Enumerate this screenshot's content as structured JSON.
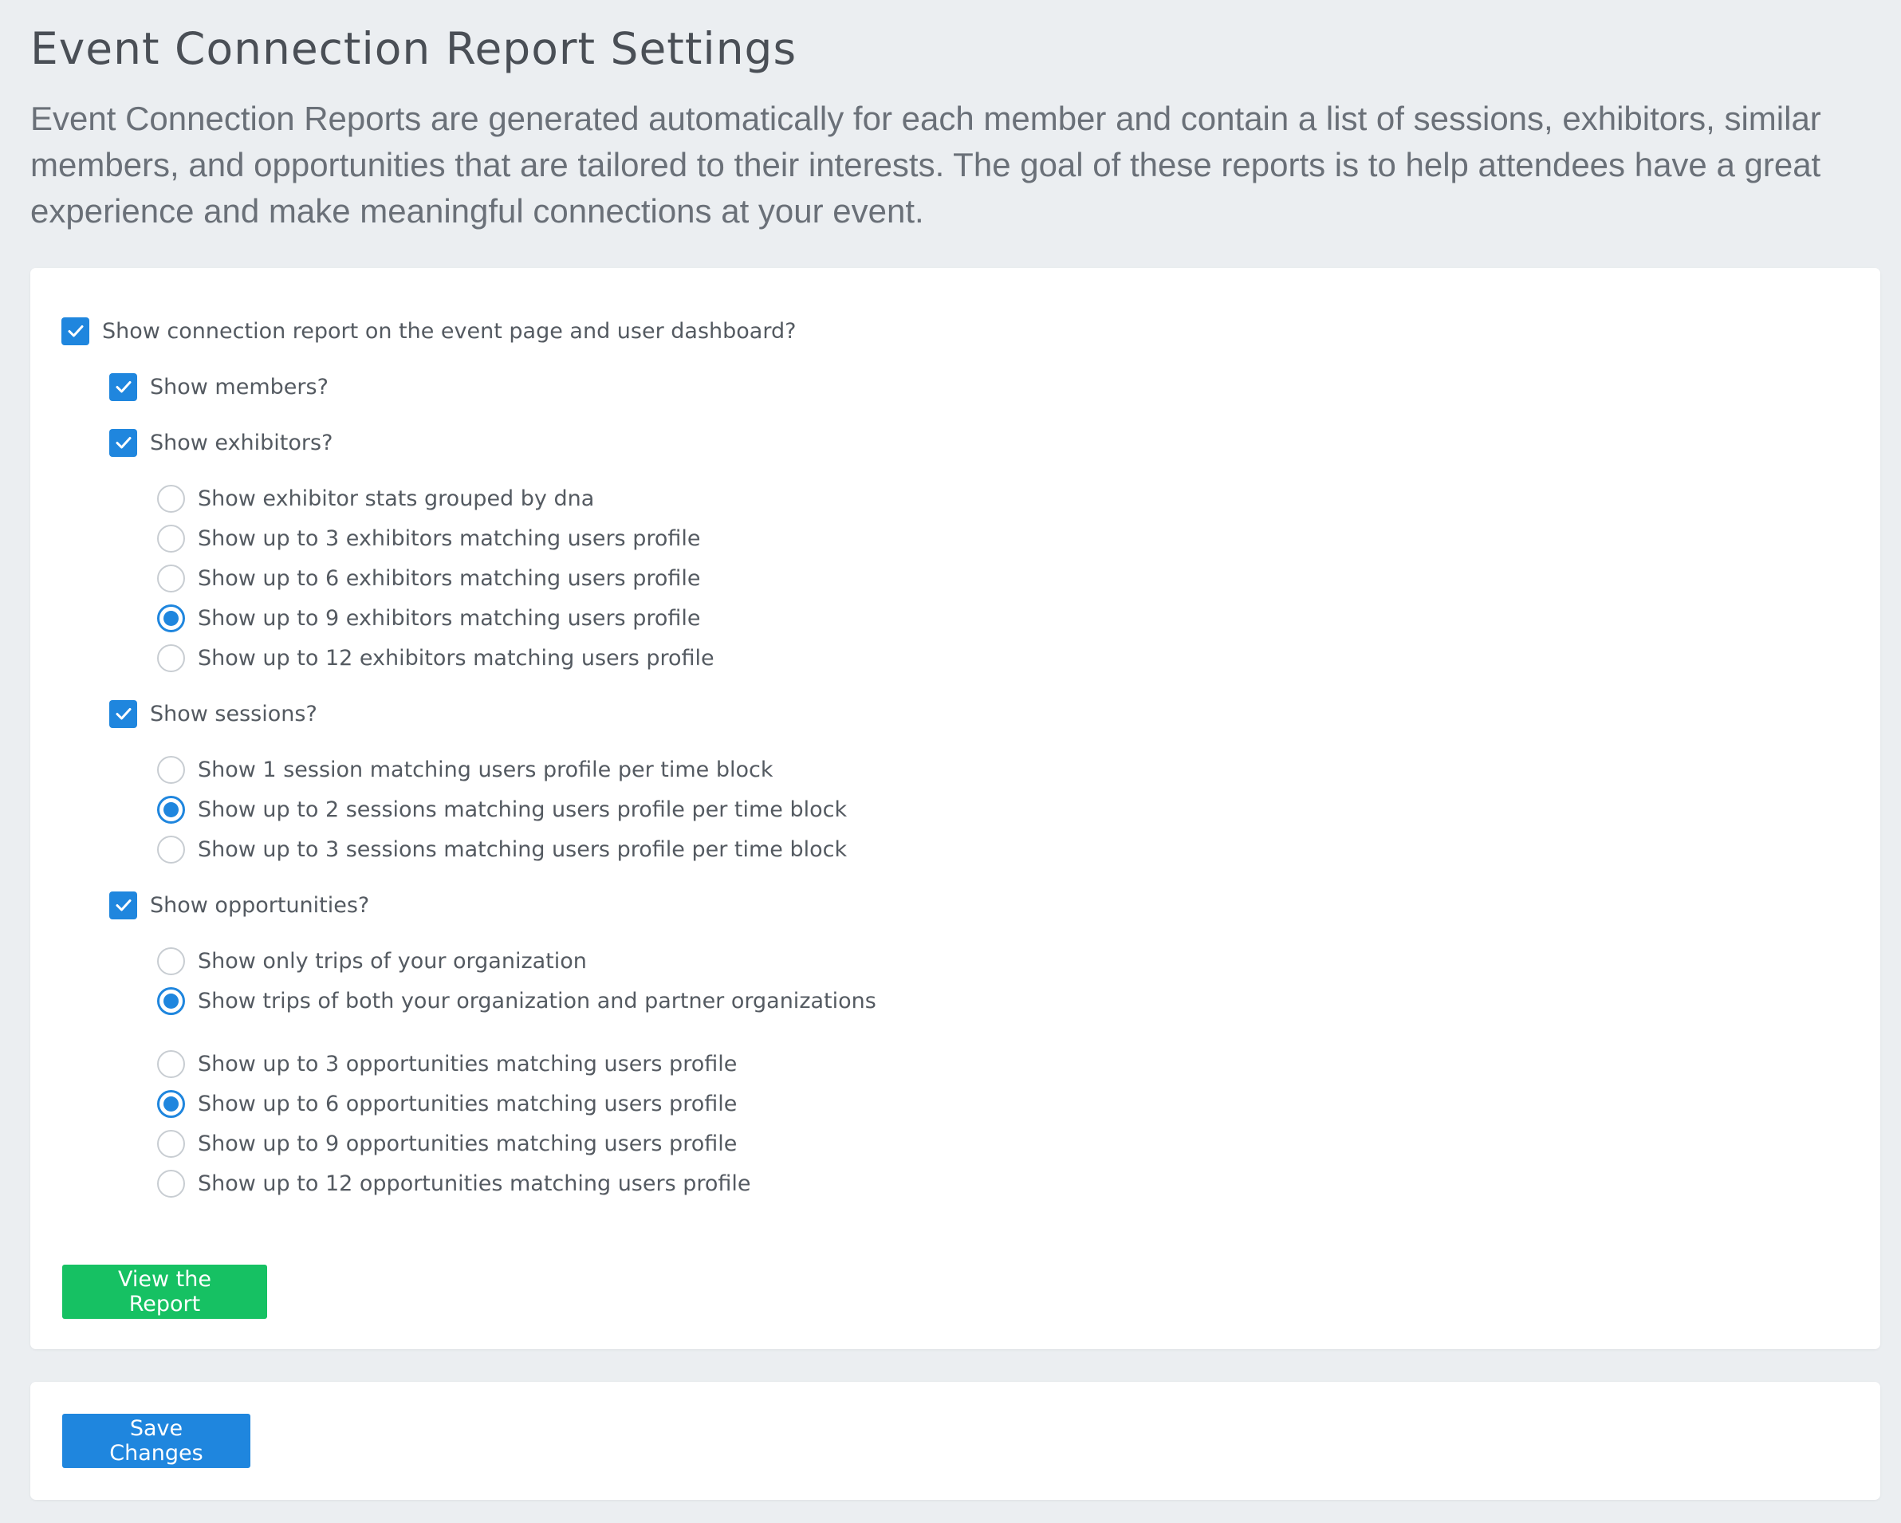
{
  "header": {
    "title": "Event Connection Report Settings",
    "description": "Event Connection Reports are generated automatically for each member and contain a list of sessions, exhibitors, similar members, and opportunities that are tailored to their interests. The goal of these reports is to help attendees have a great experience and make meaningful connections at your event."
  },
  "settings": {
    "show_report": {
      "label": "Show connection report on the event page and user dashboard?",
      "checked": true
    },
    "show_members": {
      "label": "Show members?",
      "checked": true
    },
    "show_exhibitors": {
      "label": "Show exhibitors?",
      "checked": true
    },
    "exhibitor_options": [
      {
        "label": "Show exhibitor stats grouped by dna",
        "selected": false
      },
      {
        "label": "Show up to 3 exhibitors matching users profile",
        "selected": false
      },
      {
        "label": "Show up to 6 exhibitors matching users profile",
        "selected": false
      },
      {
        "label": "Show up to 9 exhibitors matching users profile",
        "selected": true
      },
      {
        "label": "Show up to 12 exhibitors matching users profile",
        "selected": false
      }
    ],
    "show_sessions": {
      "label": "Show sessions?",
      "checked": true
    },
    "session_options": [
      {
        "label": "Show 1 session matching users profile per time block",
        "selected": false
      },
      {
        "label": "Show up to 2 sessions matching users profile per time block",
        "selected": true
      },
      {
        "label": "Show up to 3 sessions matching users profile per time block",
        "selected": false
      }
    ],
    "show_opportunities": {
      "label": "Show opportunities?",
      "checked": true
    },
    "trip_options": [
      {
        "label": "Show only trips of your organization",
        "selected": false
      },
      {
        "label": "Show trips of both your organization and partner organizations",
        "selected": true
      }
    ],
    "opportunity_count_options": [
      {
        "label": "Show up to 3 opportunities matching users profile",
        "selected": false
      },
      {
        "label": "Show up to 6 opportunities matching users profile",
        "selected": true
      },
      {
        "label": "Show up to 9 opportunities matching users profile",
        "selected": false
      },
      {
        "label": "Show up to 12 opportunities matching users profile",
        "selected": false
      }
    ]
  },
  "buttons": {
    "view_report": "View the Report",
    "save_changes": "Save Changes"
  },
  "colors": {
    "accent": "#1f86de",
    "success": "#16c163",
    "background": "#ebeef1"
  }
}
